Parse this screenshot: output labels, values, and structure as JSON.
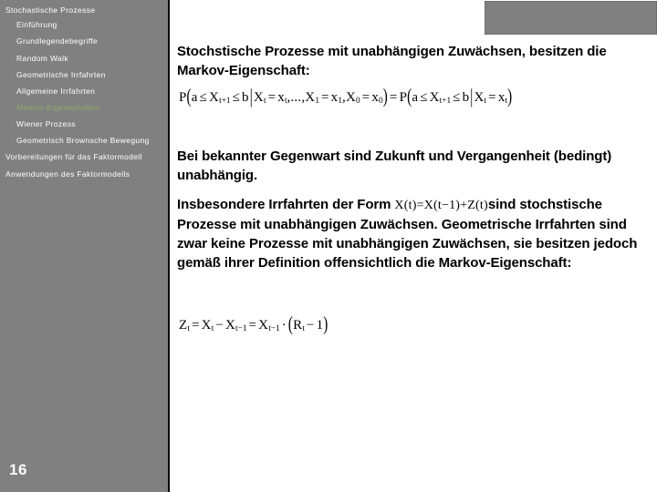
{
  "slide": {
    "page_number": "16",
    "background_color": "#ffffff"
  },
  "sidebar": {
    "background_color": "#808080",
    "text_color": "#ffffff",
    "active_color": "#8fab68",
    "items": [
      {
        "label": "Stochastische Prozesse",
        "level": 0,
        "active": false
      },
      {
        "label": "Einführung",
        "level": 1,
        "active": false
      },
      {
        "label": "Grundlegendebegriffe",
        "level": 1,
        "active": false
      },
      {
        "label": "Random Walk",
        "level": 1,
        "active": false
      },
      {
        "label": "Geometrische Irrfahrten",
        "level": 1,
        "active": false
      },
      {
        "label": "Allgemeine Irrfahrten",
        "level": 1,
        "active": false
      },
      {
        "label": "Markov-Eigenschaften",
        "level": 1,
        "active": true
      },
      {
        "label": "Wiener Prozess",
        "level": 1,
        "active": false
      },
      {
        "label": "Geometrisch Brownsche Bewegung",
        "level": 1,
        "active": false
      },
      {
        "label": "Vorbereitungen für das Faktormodell",
        "level": 0,
        "active": false
      },
      {
        "label": "Anwendungen des Faktormodells",
        "level": 0,
        "active": false
      }
    ]
  },
  "header_block": {
    "color": "#808080"
  },
  "content": {
    "paragraph_title": "Stochstische Prozesse mit unabhängigen Zuwächsen, besitzen die Markov-Eigenschaft:",
    "paragraph_known_present": "Bei bekannter Gegenwart sind Zukunft und Vergangenheit (bedingt) unabhängig.",
    "paragraph_special_part1": "Insbesondere Irrfahrten der Form ",
    "paragraph_special_inline_formula": "X(t) = X(t-1) + Z(t)",
    "paragraph_special_part2": "sind stochstische Prozesse mit unabhängigen Zuwächsen. Geometrische Irrfahrten sind zwar keine Prozesse mit unabhängigen Zuwächsen, sie besitzen jedoch gemäß ihrer Definition offensichtlich die Markov-Eigenschaft:",
    "formula_markov_property": "P(a ≤ X t+1 ≤ b | X t = x t , ... , X 1 = x 1 , X 0 = x 0 ) = P(a ≤ X t+1 ≤ b | X t = x t )",
    "formula_increment": "Z t = X t − X t−1 = X t−1 · (R t − 1)",
    "formula_markov_parts": {
      "p1": "P",
      "a": "a",
      "le1": "≤",
      "X": "X",
      "sub_tp1": "t+1",
      "le2": "≤",
      "b": "b",
      "bar": "|",
      "eq": "=",
      "x": "x",
      "sub_t": "t",
      "ellipsis": ",...,",
      "sub_1": "1",
      "sub_0": "0",
      "equals": "="
    },
    "formula_increment_parts": {
      "Z": "Z",
      "X": "X",
      "R": "R",
      "sub_t": "t",
      "sub_tm1": "t−1",
      "minus": "−",
      "eq": "=",
      "dot": "·",
      "one": "1"
    }
  }
}
